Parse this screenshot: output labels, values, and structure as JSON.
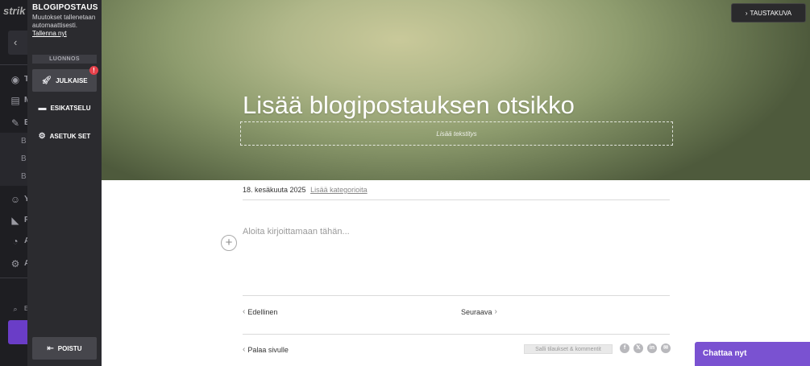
{
  "app_sidebar": {
    "logo_text": "strik",
    "back_label": "‹",
    "nav_initials": [
      "T",
      "M",
      "B",
      "Y",
      "F",
      "A",
      "A"
    ],
    "sub_items": [
      "B",
      "B",
      "B"
    ],
    "search_label": "ES"
  },
  "editor_panel": {
    "title": "BLOGIPOSTAUS",
    "autosave_text": "Muutokset tallenetaan automaattisesti.",
    "save_now_link": "Tallenna nyt",
    "status": "LUONNOS",
    "publish_label": "JULKAISE",
    "publish_badge": "!",
    "preview_label": "ESIKATSELU",
    "settings_label": "ASETUK SET",
    "exit_label": "POISTU"
  },
  "hero": {
    "background_button_label": "TAUSTAKUVA",
    "title": "Lisää blogipostauksen otsikko",
    "subtitle_placeholder": "Lisää tekstitys"
  },
  "post": {
    "date": "18. kesäkuuta 2025",
    "add_category_link": "Lisää kategorioita",
    "body_placeholder": "Aloita kirjoittamaan tähän...",
    "add_block_label": "+"
  },
  "navigation": {
    "prev_label": "Edellinen",
    "next_label": "Seuraava",
    "back_label": "Palaa sivulle"
  },
  "footer": {
    "comments_toggle_label": "Salli tilaukset & kommentit",
    "share_icons": [
      "f",
      "𝕏",
      "in",
      "✉"
    ]
  },
  "chat": {
    "label": "Chattaa nyt"
  },
  "colors": {
    "panel_bg": "#2b2b2f",
    "badge": "#e7414b",
    "chat": "#7a52d1"
  }
}
